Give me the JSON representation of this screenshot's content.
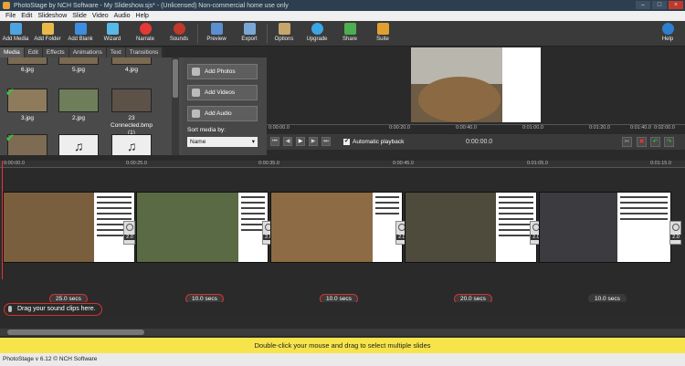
{
  "window": {
    "title": "PhotoStage by NCH Software - My Slideshow.sjs* - (Unlicensed) Non-commercial home use only"
  },
  "menu": [
    "File",
    "Edit",
    "Slideshow",
    "Slide",
    "Video",
    "Audio",
    "Help"
  ],
  "toolbar": {
    "add_media": "Add Media",
    "add_folder": "Add Folder",
    "add_blank": "Add Blank",
    "wizard": "Wizard",
    "narrate": "Narrate",
    "sounds": "Sounds",
    "preview": "Preview",
    "export": "Export",
    "options": "Options",
    "upgrade": "Upgrade",
    "share": "Share",
    "suite": "Suite",
    "help": "Help"
  },
  "tabs": [
    "Media",
    "Edit",
    "Effects",
    "Animations",
    "Text",
    "Transitions"
  ],
  "media": {
    "items": [
      {
        "caption": "6.jpg",
        "checked": false,
        "type": "photo"
      },
      {
        "caption": "5.jpg",
        "checked": false,
        "type": "photo"
      },
      {
        "caption": "4.jpg",
        "checked": false,
        "type": "photo"
      },
      {
        "caption": "3.jpg",
        "checked": true,
        "type": "photo"
      },
      {
        "caption": "2.jpg",
        "checked": false,
        "type": "photo"
      },
      {
        "caption": "23 Connected.bmp (1)",
        "checked": false,
        "type": "photo"
      },
      {
        "caption": "",
        "checked": true,
        "type": "photo"
      },
      {
        "caption": "",
        "checked": false,
        "type": "music"
      },
      {
        "caption": "",
        "checked": false,
        "type": "music"
      }
    ]
  },
  "add_panel": {
    "add_photos": "Add Photos",
    "add_videos": "Add Videos",
    "add_audio": "Add Audio",
    "sort_label": "Sort media by:",
    "sort_value": "Name"
  },
  "preview": {
    "ruler": [
      "0:00:00.0",
      "0:00:20.0",
      "0:00:40.0",
      "0:01:00.0",
      "0:01:20.0",
      "0:01:40.0",
      "0:02:00.0"
    ],
    "autoplay_label": "Automatic playback",
    "time": "0:00:00.0"
  },
  "timeline": {
    "ruler": [
      "0:00:00.0",
      "0:00:25.0",
      "0:00:35.0",
      "0:00:45.0",
      "0:01:05.0",
      "0:01:15.0"
    ],
    "slides": [
      {
        "duration": "25.0 secs",
        "transition": "2.0"
      },
      {
        "duration": "10.0 secs",
        "transition": "2.0"
      },
      {
        "duration": "10.0 secs",
        "transition": "2.0"
      },
      {
        "duration": "20.0 secs",
        "transition": "2.0"
      },
      {
        "duration": "10.0 secs",
        "transition": "2.0"
      }
    ],
    "sound_hint": "Drag your sound clips here."
  },
  "hint": "Double-click your mouse and drag to select multiple slides",
  "status": "PhotoStage v 6.12 © NCH Software",
  "colors": {
    "accent_red": "#d93030",
    "hint_bg": "#f7e44a"
  }
}
